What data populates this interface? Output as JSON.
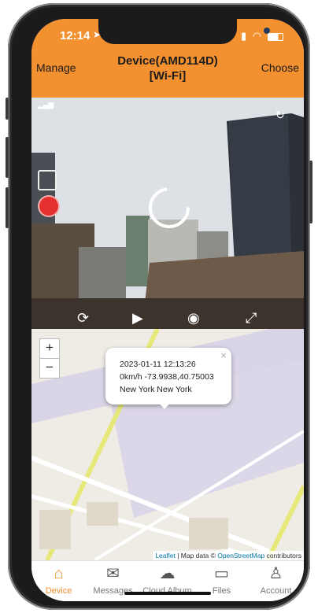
{
  "status_bar": {
    "time": "12:14"
  },
  "header": {
    "left_label": "Manage",
    "title_line1": "Device(AMD114D)",
    "title_line2": "[Wi-Fi]",
    "right_label": "Choose"
  },
  "map": {
    "popup": {
      "datetime": "2023-01-11 12:13:26",
      "speed_coords": "0km/h -73.9938,40.75003",
      "location": "New York New York",
      "close": "×"
    },
    "zoom_in": "+",
    "zoom_out": "−",
    "attribution": {
      "leaflet": "Leaflet",
      "sep": " | Map data © ",
      "osm": "OpenStreetMap",
      "tail": " contributors"
    }
  },
  "tabs": [
    {
      "label": "Device",
      "icon": "home-icon"
    },
    {
      "label": "Messages",
      "icon": "envelope-icon"
    },
    {
      "label": "Cloud Album",
      "icon": "cloud-icon"
    },
    {
      "label": "Files",
      "icon": "folder-icon"
    },
    {
      "label": "Account",
      "icon": "person-icon"
    }
  ],
  "colors": {
    "accent": "#f39030",
    "frame": "#1b1b1d"
  }
}
